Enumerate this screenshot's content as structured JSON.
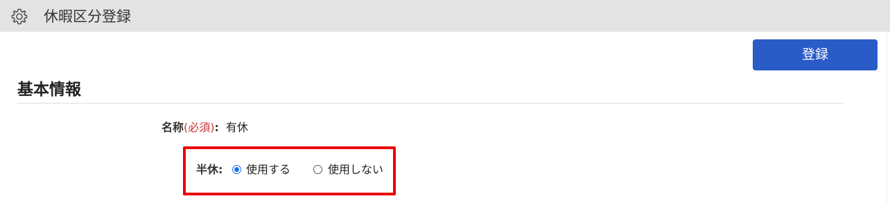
{
  "header": {
    "title": "休暇区分登録",
    "icon": "gear-icon",
    "background": "#e3e3e1"
  },
  "toolbar": {
    "register_label": "登録",
    "accent": "#2a5cc8"
  },
  "section": {
    "title": "基本情報"
  },
  "form": {
    "name_label": "名称",
    "required_text": "(必須)",
    "name_colon": ":",
    "name_value": "有休",
    "half_label": "半休",
    "half_colon": ":",
    "half_options": [
      {
        "label": "使用する",
        "selected": true
      },
      {
        "label": "使用しない",
        "selected": false
      }
    ],
    "highlight_color": "#ee0000",
    "required_color": "#cc3333"
  }
}
